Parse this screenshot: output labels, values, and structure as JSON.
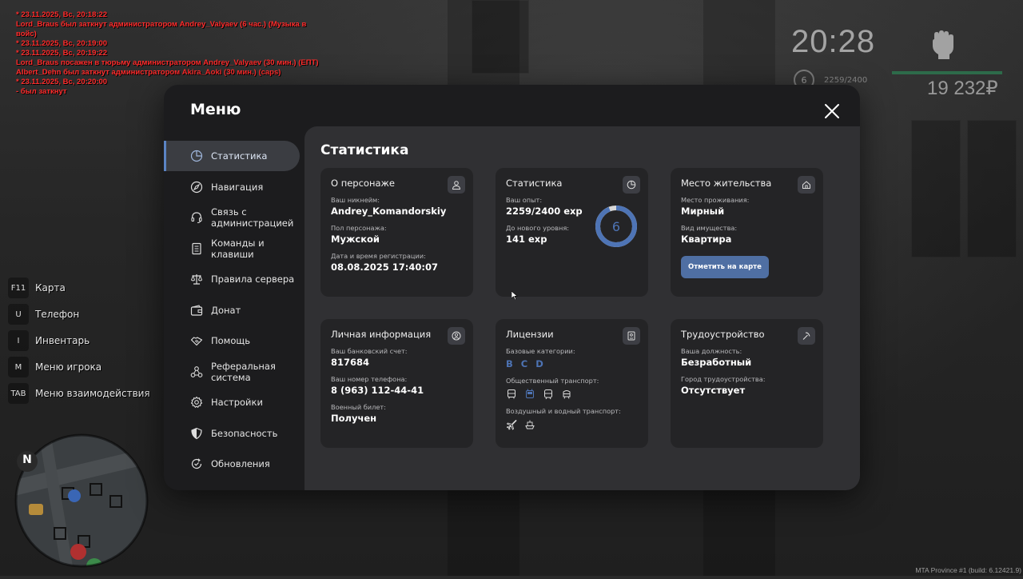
{
  "chat": [
    "* 23.11.2025, Вс, 20:18:22",
    "Lord_Braus был заткнут администратором Andrey_Valyaev (6 час.) (Музыка в войс)",
    "* 23.11.2025, Вс, 20:19:00",
    "* 23.11.2025, Вс, 20:19:22",
    "Lord_Braus посажен в тюрьму администратором Andrey_Valyaev (30 мин.) (ЕПТ)",
    "Albert_Dehn был заткнут администратором Akira_Aoki (30 мин.) (caps)",
    "* 23.11.2025, Вс, 20:20:00",
    "- был заткнут"
  ],
  "hud": {
    "time": "20:28",
    "level": "6",
    "exp": "2259/2400",
    "money": "19 232₽"
  },
  "keybinds": [
    {
      "key": "F11",
      "label": "Карта"
    },
    {
      "key": "U",
      "label": "Телефон"
    },
    {
      "key": "I",
      "label": "Инвентарь"
    },
    {
      "key": "M",
      "label": "Меню игрока"
    },
    {
      "key": "TAB",
      "label": "Меню взаимодействия"
    }
  ],
  "minimap": {
    "north": "N"
  },
  "watermark": "MTA Province #1 (build: 6.12421.9)",
  "menu": {
    "title": "Меню",
    "nav": [
      {
        "label": "Статистика",
        "icon": "pie-chart-icon",
        "active": true
      },
      {
        "label": "Навигация",
        "icon": "compass-icon"
      },
      {
        "label": "Связь с администрацией",
        "icon": "headset-icon"
      },
      {
        "label": "Команды и клавиши",
        "icon": "document-icon"
      },
      {
        "label": "Правила сервера",
        "icon": "scales-icon"
      },
      {
        "label": "Донат",
        "icon": "wallet-icon"
      },
      {
        "label": "Помощь",
        "icon": "handshake-icon"
      },
      {
        "label": "Реферальная система",
        "icon": "network-icon"
      },
      {
        "label": "Настройки",
        "icon": "gear-icon"
      },
      {
        "label": "Безопасность",
        "icon": "shield-icon"
      },
      {
        "label": "Обновления",
        "icon": "refresh-check-icon"
      }
    ],
    "content_title": "Статистика",
    "cards": {
      "character": {
        "title": "О персонаже",
        "nickname_label": "Ваш никнейм:",
        "nickname": "Andrey_Komandorskiy",
        "gender_label": "Пол персонажа:",
        "gender": "Мужской",
        "reg_label": "Дата и время регистрации:",
        "reg": "08.08.2025 17:40:07"
      },
      "stats": {
        "title": "Статистика",
        "exp_label": "Ваш опыт:",
        "exp": "2259/2400 exp",
        "next_label": "До нового уровня:",
        "next": "141 exp",
        "level": "6",
        "progress": 0.94
      },
      "residence": {
        "title": "Место жительства",
        "place_label": "Место проживания:",
        "place": "Мирный",
        "property_label": "Вид имущества:",
        "property": "Квартира",
        "button": "Отметить на карте"
      },
      "personal": {
        "title": "Личная информация",
        "bank_label": "Ваш банковский счет:",
        "bank": "817684",
        "phone_label": "Ваш номер телефона:",
        "phone": "8 (963) 112-44-41",
        "military_label": "Военный билет:",
        "military": "Получен"
      },
      "licenses": {
        "title": "Лицензии",
        "base_label": "Базовые категории:",
        "categories": [
          "B",
          "C",
          "D"
        ],
        "public_label": "Общественный транспорт:",
        "air_label": "Воздушный и водный транспорт:"
      },
      "employment": {
        "title": "Трудоустройство",
        "position_label": "Ваша должность:",
        "position": "Безработный",
        "city_label": "Город трудоустройства:",
        "city": "Отсутствует"
      }
    }
  },
  "colors": {
    "accent": "#5b84c4",
    "button": "#4f6fa3",
    "panel": "#1c1c1e",
    "content": "#303033",
    "card": "#242426",
    "chat": "#ff2b2b"
  }
}
